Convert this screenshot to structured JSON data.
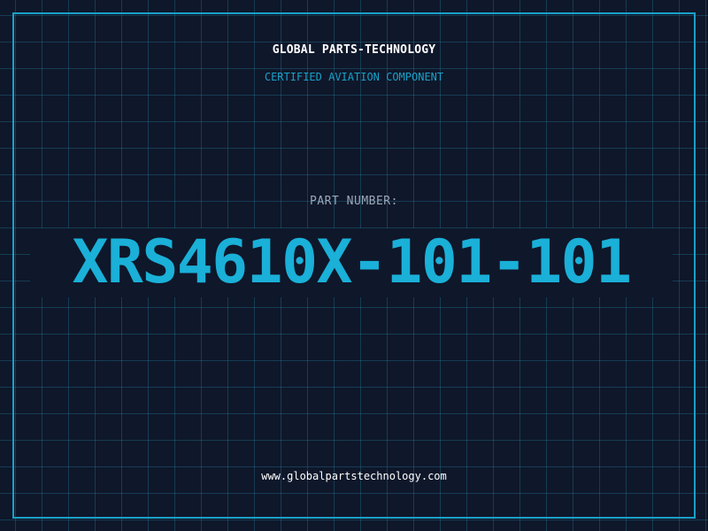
{
  "header": {
    "brand": "GLOBAL PARTS-TECHNOLOGY",
    "tagline": "CERTIFIED AVIATION COMPONENT"
  },
  "part": {
    "label": "PART NUMBER:",
    "number": "XRS4610X-101-101"
  },
  "footer": {
    "url": "www.globalpartstechnology.com"
  },
  "colors": {
    "background": "#0f172a",
    "accent": "#1ab0d8",
    "grid": "#2282a0",
    "label": "#9ba8b8",
    "text": "#ffffff"
  }
}
